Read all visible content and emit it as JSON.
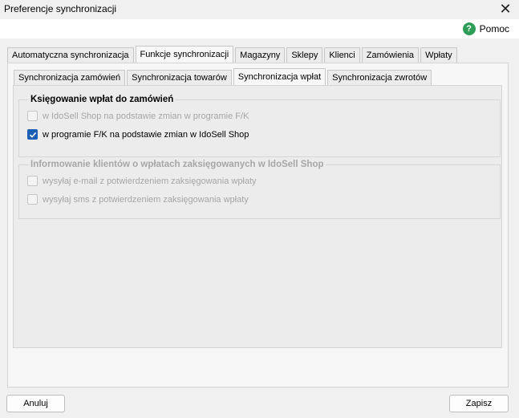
{
  "window": {
    "title": "Preferencje synchronizacji",
    "close_glyph": "✕"
  },
  "help": {
    "icon_glyph": "?",
    "label": "Pomoc",
    "icon_color": "#2e9d57"
  },
  "main_tabs": [
    {
      "label": "Automatyczna synchronizacja",
      "active": false
    },
    {
      "label": "Funkcje synchronizacji",
      "active": true
    },
    {
      "label": "Magazyny",
      "active": false
    },
    {
      "label": "Sklepy",
      "active": false
    },
    {
      "label": "Klienci",
      "active": false
    },
    {
      "label": "Zamówienia",
      "active": false
    },
    {
      "label": "Wpłaty",
      "active": false
    }
  ],
  "sub_tabs": [
    {
      "label": "Synchronizacja zamówień",
      "active": false
    },
    {
      "label": "Synchronizacja towarów",
      "active": false
    },
    {
      "label": "Synchronizacja wpłat",
      "active": true
    },
    {
      "label": "Synchronizacja zwrotów",
      "active": false
    }
  ],
  "group_posting": {
    "legend": "Księgowanie wpłat do zamówień",
    "options": [
      {
        "label": "w IdoSell Shop na podstawie zmian w programie F/K",
        "checked": false,
        "enabled": false
      },
      {
        "label": "w programie F/K na podstawie zmian w IdoSell Shop",
        "checked": true,
        "enabled": true
      }
    ]
  },
  "group_notify": {
    "legend": "Informowanie klientów o wpłatach zaksięgowanych w IdoSell Shop",
    "enabled": false,
    "options": [
      {
        "label": "wysyłaj e-mail z potwierdzeniem zaksięgowania wpłaty",
        "checked": false,
        "enabled": false
      },
      {
        "label": "wysyłaj sms z potwierdzeniem zaksięgowania wpłaty",
        "checked": false,
        "enabled": false
      }
    ]
  },
  "buttons": {
    "cancel": "Anuluj",
    "save": "Zapisz"
  },
  "colors": {
    "accent": "#1a5fb4",
    "window_bg": "#f0f0f0",
    "disabled_text": "#a6a6a6"
  }
}
